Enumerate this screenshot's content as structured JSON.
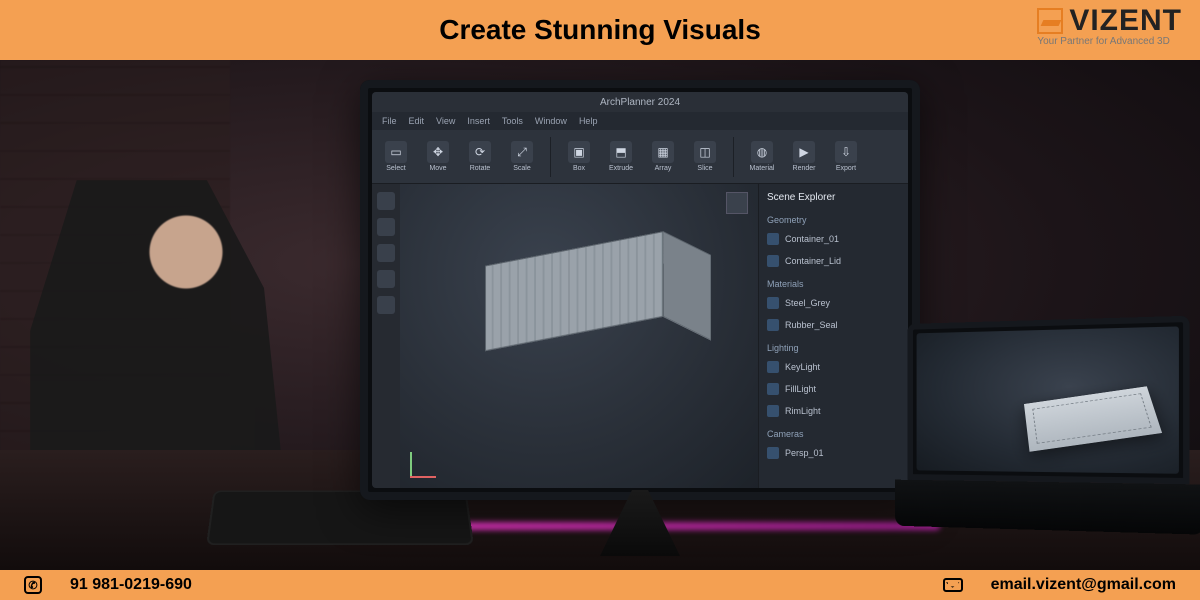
{
  "header": {
    "title": "Create Stunning Visuals"
  },
  "logo": {
    "name": "VIZENT",
    "tagline": "Your Partner for Advanced 3D"
  },
  "cad_app": {
    "window_title": "ArchPlanner 2024",
    "menu": [
      "File",
      "Edit",
      "View",
      "Insert",
      "Tools",
      "Window",
      "Help"
    ],
    "ribbon_tools": [
      "Select",
      "Move",
      "Rotate",
      "Scale",
      "Box",
      "Extrude",
      "Array",
      "Slice",
      "Material",
      "Render",
      "Export"
    ],
    "panel": {
      "title": "Scene Explorer",
      "sections": [
        {
          "name": "Geometry",
          "items": [
            "Container_01",
            "Container_Lid"
          ]
        },
        {
          "name": "Materials",
          "items": [
            "Steel_Grey",
            "Rubber_Seal"
          ]
        },
        {
          "name": "Lighting",
          "items": [
            "KeyLight",
            "FillLight",
            "RimLight"
          ]
        },
        {
          "name": "Cameras",
          "items": [
            "Persp_01"
          ]
        }
      ]
    }
  },
  "footer": {
    "phone": "91 981-0219-690",
    "email": "email.vizent@gmail.com"
  }
}
